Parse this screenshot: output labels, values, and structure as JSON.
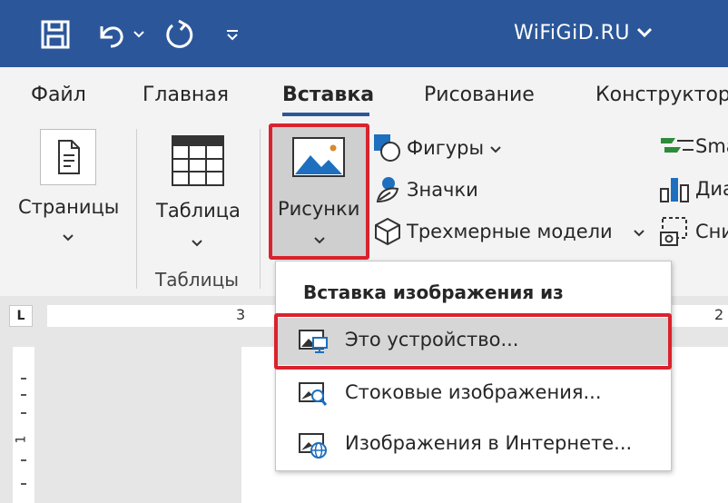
{
  "titlebar": {
    "title": "WiFiGiD.RU",
    "icons": [
      "save-icon",
      "undo-icon",
      "undo-dropdown-icon",
      "redo-icon",
      "customize-quick-access-icon"
    ]
  },
  "tabs": [
    {
      "label": "Файл",
      "active": false
    },
    {
      "label": "Главная",
      "active": false
    },
    {
      "label": "Вставка",
      "active": true
    },
    {
      "label": "Рисование",
      "active": false
    },
    {
      "label": "Конструктор",
      "active": false
    }
  ],
  "ribbon": {
    "pages": {
      "label": "Страницы"
    },
    "table": {
      "label": "Таблица",
      "group_label": "Таблицы"
    },
    "pictures": {
      "label": "Рисунки"
    },
    "shapes": {
      "label": "Фигуры"
    },
    "icons": {
      "label": "Значки"
    },
    "models3d": {
      "label": "Трехмерные модели"
    },
    "smartart": {
      "label": "Sma"
    },
    "chart": {
      "label": "Диа"
    },
    "screenshot": {
      "label": "Сни"
    }
  },
  "ruler": {
    "corner": "L",
    "mark_3": "3",
    "mark_2": "2",
    "vmark_1": "1"
  },
  "menu": {
    "title": "Вставка изображения из",
    "items": [
      {
        "label": "Это устройство...",
        "icon": "image-device-icon",
        "highlighted": true
      },
      {
        "label": "Стоковые изображения...",
        "icon": "image-stock-search-icon",
        "highlighted": false
      },
      {
        "label": "Изображения в Интернете...",
        "icon": "image-online-globe-icon",
        "highlighted": false
      }
    ]
  },
  "colors": {
    "titlebar": "#2b579a",
    "accent_underline": "#2b579a",
    "highlight_border": "#d9232e",
    "ribbon_bg": "#f3f3f3",
    "icon_blue": "#1e6fbf"
  }
}
